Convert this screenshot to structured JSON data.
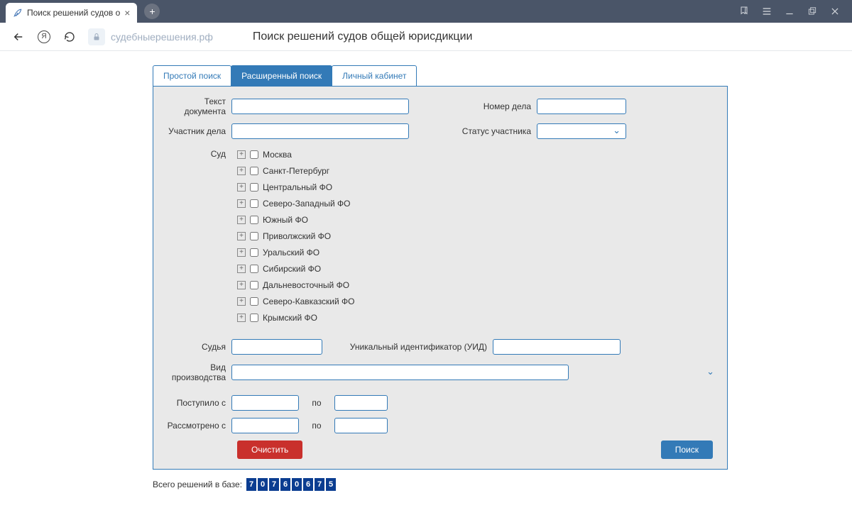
{
  "browser": {
    "tab_title": "Поиск решений судов о",
    "url": "судебныерешения.рф",
    "page_title": "Поиск решений судов общей юрисдикции"
  },
  "tabs": {
    "simple": "Простой поиск",
    "advanced": "Расширенный поиск",
    "cabinet": "Личный кабинет"
  },
  "labels": {
    "doc_text": "Текст документа",
    "case_no": "Номер дела",
    "participant": "Участник дела",
    "status": "Статус участника",
    "court": "Суд",
    "judge": "Судья",
    "uid": "Уникальный идентификатор (УИД)",
    "proc_type": "Вид производства",
    "received_from": "Поступило с",
    "reviewed_from": "Рассмотрено с",
    "to": "по"
  },
  "courts": [
    "Москва",
    "Санкт-Петербург",
    "Центральный ФО",
    "Северо-Западный ФО",
    "Южный ФО",
    "Приволжский ФО",
    "Уральский ФО",
    "Сибирский ФО",
    "Дальневосточный ФО",
    "Северо-Кавказский ФО",
    "Крымский ФО"
  ],
  "buttons": {
    "clear": "Очистить",
    "search": "Поиск"
  },
  "footer": {
    "label": "Всего решений в базе:",
    "digits": [
      "7",
      "0",
      "7",
      "6",
      "0",
      "6",
      "7",
      "5"
    ]
  }
}
